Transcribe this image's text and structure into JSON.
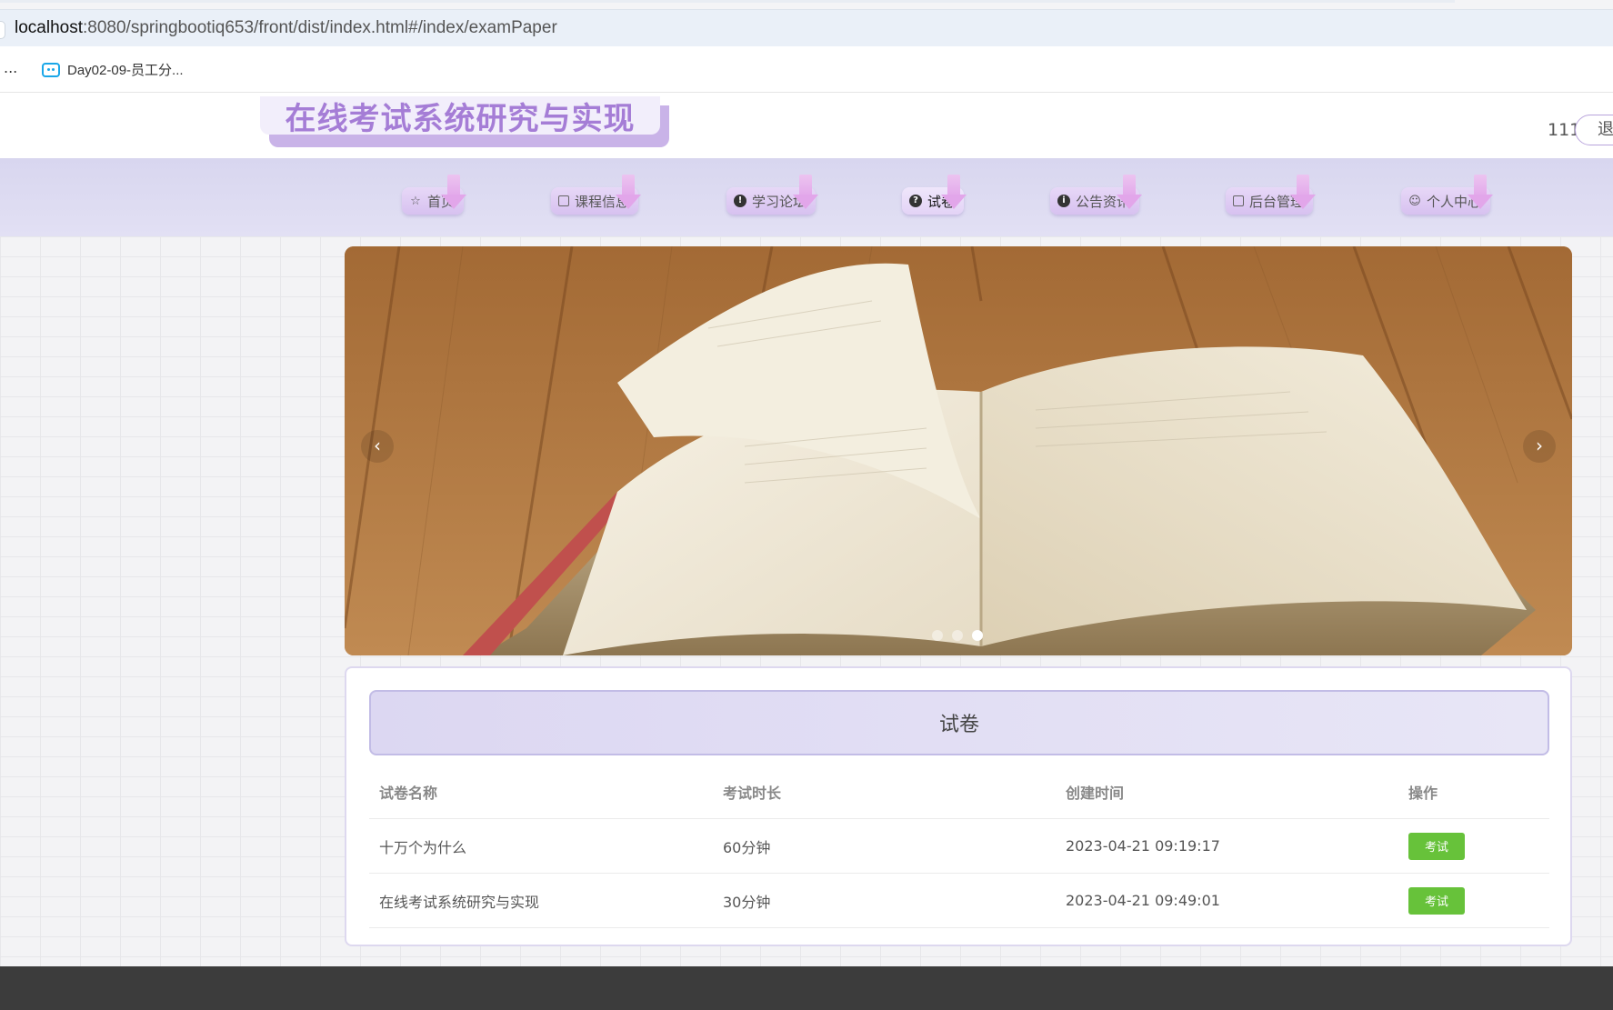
{
  "browser": {
    "url_host": "localhost",
    "url_rest": ":8080/springbootiq653/front/dist/index.html#/index/examPaper",
    "bookmarks_overflow": "...",
    "bookmark_label": "Day02-09-员工分..."
  },
  "header": {
    "site_title": "在线考试系统研究与实现",
    "user_name": "111",
    "logout_label": "退"
  },
  "nav": {
    "items": [
      {
        "label": "首页",
        "icon": "star-icon"
      },
      {
        "label": "课程信息",
        "icon": "bag-icon"
      },
      {
        "label": "学习论坛",
        "icon": "exclamation-icon"
      },
      {
        "label": "试卷",
        "icon": "question-icon"
      },
      {
        "label": "公告资讯",
        "icon": "info-icon"
      },
      {
        "label": "后台管理",
        "icon": "document-icon"
      },
      {
        "label": "个人中心",
        "icon": "user-icon"
      }
    ],
    "active_index": 3
  },
  "carousel": {
    "prev_label": "‹",
    "next_label": "›",
    "slide_count": 3,
    "active_slide": 3
  },
  "exam_panel": {
    "title": "试卷",
    "columns": [
      "试卷名称",
      "考试时长",
      "创建时间",
      "操作"
    ],
    "rows": [
      {
        "name": "十万个为什么",
        "duration": "60分钟",
        "created": "2023-04-21 09:19:17",
        "action": "考试"
      },
      {
        "name": "在线考试系统研究与实现",
        "duration": "30分钟",
        "created": "2023-04-21 09:49:01",
        "action": "考试"
      }
    ]
  },
  "colors": {
    "accent_purple": "#a57dd6",
    "nav_bg": "#d8d6ef",
    "exam_button": "#67c23a",
    "footer": "#3c3c3c"
  }
}
